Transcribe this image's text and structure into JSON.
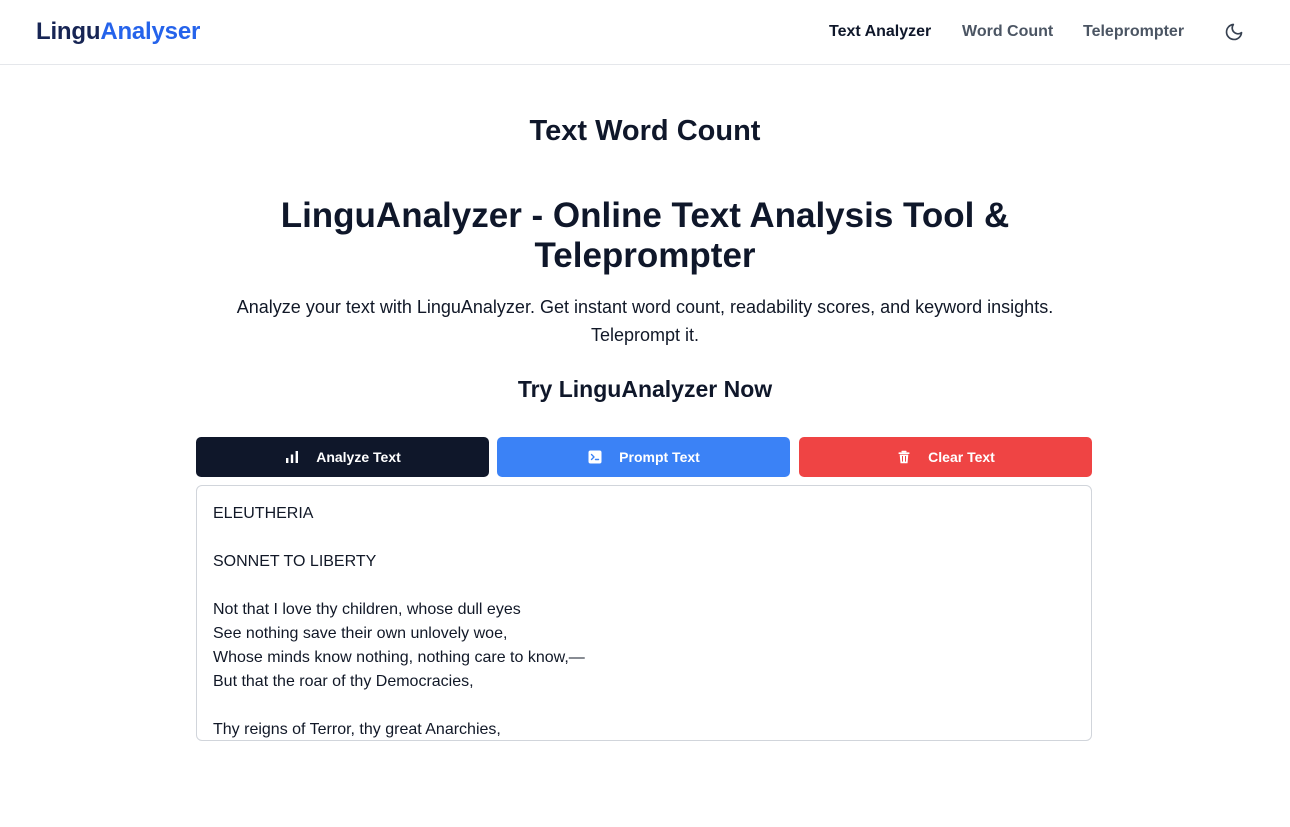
{
  "header": {
    "brand_part1": "Lingu",
    "brand_part2": "Analyser",
    "nav": [
      {
        "label": "Text Analyzer"
      },
      {
        "label": "Word Count"
      },
      {
        "label": "Teleprompter"
      }
    ],
    "theme_icon": "moon-icon"
  },
  "main": {
    "page_title": "Text Word Count",
    "hero_title_line1": "LinguAnalyzer - Online Text Analysis Tool &",
    "hero_title_line2": "Teleprompter",
    "hero_desc_line1": "Analyze your text with LinguAnalyzer. Get instant word count, readability scores, and keyword insights.",
    "hero_desc_line2": "Teleprompt it.",
    "cta_heading": "Try LinguAnalyzer Now"
  },
  "actions": {
    "analyze_label": "Analyze Text",
    "analyze_icon": "bar-chart-icon",
    "prompt_label": "Prompt Text",
    "prompt_icon": "terminal-icon",
    "clear_label": "Clear Text",
    "clear_icon": "trash-icon"
  },
  "editor": {
    "lines": [
      "ELEUTHERIA",
      "",
      "SONNET TO LIBERTY",
      "",
      "Not that I love thy children, whose dull eyes",
      "See nothing save their own unlovely woe,",
      "Whose minds know nothing, nothing care to know,—",
      "But that the roar of thy Democracies,",
      "",
      "Thy reigns of Terror, thy great Anarchies,"
    ]
  },
  "colors": {
    "brand_dark": "#172554",
    "brand_blue": "#2563eb",
    "analyze_bg": "#0f172a",
    "prompt_bg": "#3b82f6",
    "clear_bg": "#ef4444"
  }
}
